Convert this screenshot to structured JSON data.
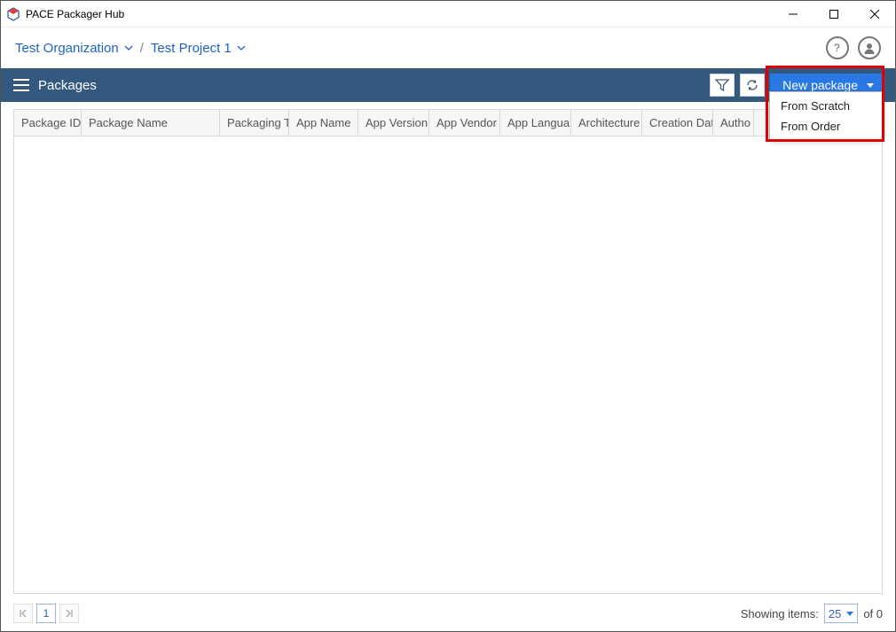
{
  "app": {
    "title": "PACE Packager Hub"
  },
  "breadcrumb": {
    "org": "Test Organization",
    "project": "Test Project 1"
  },
  "toolbar": {
    "title": "Packages",
    "new_label": "New package"
  },
  "dropdown": {
    "from_scratch": "From Scratch",
    "from_order": "From Order"
  },
  "columns": {
    "package_id": "Package ID",
    "package_name": "Package Name",
    "packaging_t": "Packaging T",
    "app_name": "App Name",
    "app_version": "App Version",
    "app_vendor": "App Vendor",
    "app_langua": "App Langua",
    "architecture": "Architecture",
    "creation_dat": "Creation Dat",
    "author": "Autho"
  },
  "footer": {
    "page": "1",
    "showing_label": "Showing items:",
    "page_size": "25",
    "of_label": "of 0"
  }
}
